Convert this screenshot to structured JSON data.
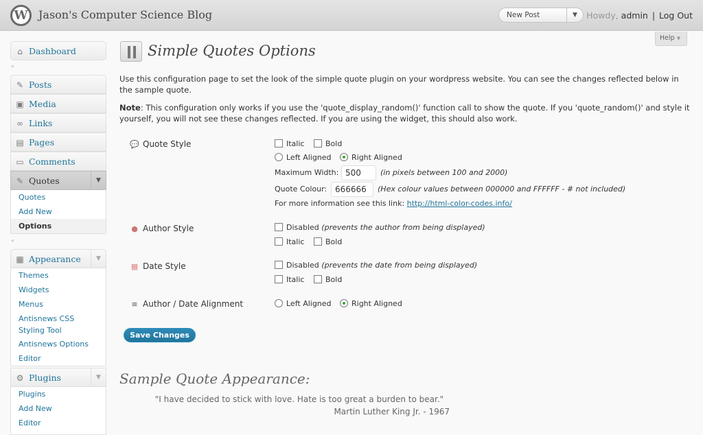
{
  "header": {
    "site_title": "Jason's Computer Science Blog",
    "logo_glyph": "W",
    "favorite_label": "New Post",
    "howdy": "Howdy,",
    "username": "admin",
    "separator": "|",
    "logout": "Log Out"
  },
  "help": {
    "label": "Help",
    "arrow": "▼"
  },
  "sidebar": {
    "dashboard": "Dashboard",
    "posts": "Posts",
    "media": "Media",
    "links": "Links",
    "pages": "Pages",
    "comments": "Comments",
    "quotes": "Quotes",
    "quotes_sub": [
      "Quotes",
      "Add New",
      "Options"
    ],
    "appearance": "Appearance",
    "appearance_sub": [
      "Themes",
      "Widgets",
      "Menus",
      "Antisnews CSS",
      "Styling Tool",
      "Antisnews Options",
      "Editor"
    ],
    "plugins": "Plugins",
    "plugins_sub": [
      "Plugins",
      "Add New",
      "Editor"
    ],
    "collapse_glyph": "«",
    "toggle_glyph": "▼"
  },
  "main": {
    "title": "Simple Quotes Options",
    "intro": "Use this configuration page to set the look of the simple quote plugin on your wordpress website. You can see the changes reflected below in the sample quote.",
    "note_label": "Note",
    "note_text": ": This configuration only works if you use the 'quote_display_random()' function call to show the quote. If you 'quote_random()' and style it yourself, you will not see these changes reflected. If you are using the widget, this should also work.",
    "quote_style": {
      "label": "Quote Style",
      "italic": "Italic",
      "bold": "Bold",
      "left_aligned": "Left Aligned",
      "right_aligned": "Right Aligned",
      "alignment_selected": "Right Aligned",
      "max_width_label": "Maximum Width:",
      "max_width_value": "500",
      "max_width_hint": "(in pixels between 100 and 2000)",
      "colour_label": "Quote Colour:",
      "colour_value": "666666",
      "colour_hint": "(Hex colour values between 000000 and FFFFFF - # not included)",
      "more_info": "For more information see this link:",
      "more_info_link": "http://html-color-codes.info/"
    },
    "author_style": {
      "label": "Author Style",
      "disabled": "Disabled",
      "disabled_hint": "(prevents the author from being displayed)",
      "italic": "Italic",
      "bold": "Bold"
    },
    "date_style": {
      "label": "Date Style",
      "disabled": "Disabled",
      "disabled_hint": "(prevents the date from being displayed)",
      "italic": "Italic",
      "bold": "Bold"
    },
    "alignment": {
      "label": "Author / Date Alignment",
      "left_aligned": "Left Aligned",
      "right_aligned": "Right Aligned",
      "selected": "Right Aligned"
    },
    "save_button": "Save Changes",
    "sample_heading": "Sample Quote Appearance:",
    "sample_quote": "\"I have decided to stick with love. Hate is too great a burden to bear.\"",
    "sample_author": "Martin Luther King Jr. - 1967"
  },
  "colors": {
    "link": "#21759b",
    "button": "#21759b",
    "header_bg": "#d9d9d9"
  }
}
